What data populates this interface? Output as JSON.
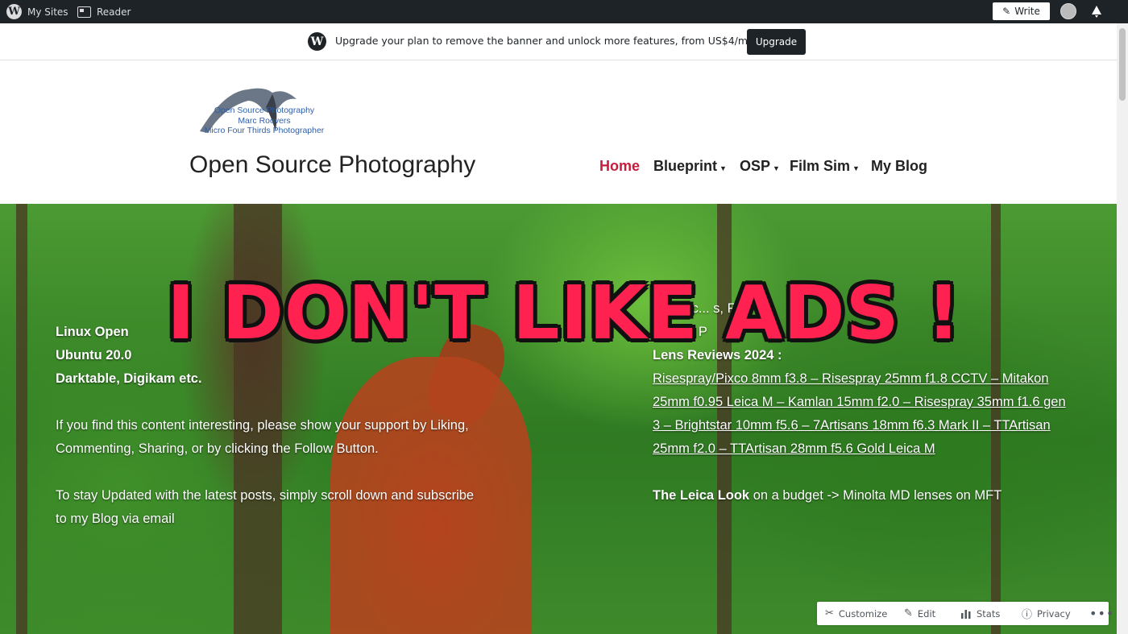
{
  "adminbar": {
    "mysites_label": "My Sites",
    "reader_label": "Reader",
    "write_label": "Write"
  },
  "banner": {
    "text": "Upgrade your plan to remove the banner and unlock more features, from US$4/month",
    "button_label": "Upgrade"
  },
  "header": {
    "logo_lines": [
      "Open Source Photography",
      "Marc Roovers",
      "Micro Four Thirds Photographer"
    ],
    "site_title": "Open Source Photography",
    "nav": [
      {
        "label": "Home",
        "active": true,
        "dropdown": false
      },
      {
        "label": "Blueprint",
        "active": false,
        "dropdown": true
      },
      {
        "label": "OSP",
        "active": false,
        "dropdown": true
      },
      {
        "label": "Film Sim",
        "active": false,
        "dropdown": true
      },
      {
        "label": "My Blog",
        "active": false,
        "dropdown": false
      }
    ],
    "accent_color": "#c81c3c"
  },
  "hero": {
    "left_bold": "Linux Open Source ... Ubuntu 20.04 LTS ... Darktable, Digikam etc.",
    "left_line1": "Linux Open",
    "left_line2": "Ubuntu 20.0",
    "left_line3": "Darktable, Digikam etc.",
    "support_text": "If you find this content interesting, please show your support by Liking, Commenting, Sharing, or by clicking the Follow Button.",
    "subscribe_text": "To stay Updated with the latest posts, simply scroll down and subscribe to my Blog via email",
    "right_top": "O... mic... s, Fi",
    "right_top2": "S... on, P",
    "lens_heading": "Lens Reviews 2024 :",
    "lens_list": "Risespray/Pixco 8mm f3.8 – Risespray 25mm f1.8 CCTV – Mitakon 25mm f0.95 Leica M – Kamlan 15mm f2.0 – Risespray 35mm f1.6 gen 3 – Brightstar 10mm f5.6 – 7Artisans 18mm f6.3 Mark II – TTArtisan 25mm f2.0 – TTArtisan 28mm f5.6 Gold Leica M",
    "leica_bold": "The Leica Look",
    "leica_rest": " on a budget -> Minolta MD lenses on MFT",
    "overlay": "I DON'T LIKE ADS !"
  },
  "actionbar": {
    "customize": "Customize",
    "edit": "Edit",
    "stats": "Stats",
    "privacy": "Privacy",
    "more": "•••"
  },
  "icons": [
    "wordpress-icon",
    "reader-icon",
    "write-icon",
    "avatar",
    "notification-icon",
    "customize-icon",
    "edit-icon",
    "stats-icon",
    "privacy-icon",
    "more-icon"
  ]
}
